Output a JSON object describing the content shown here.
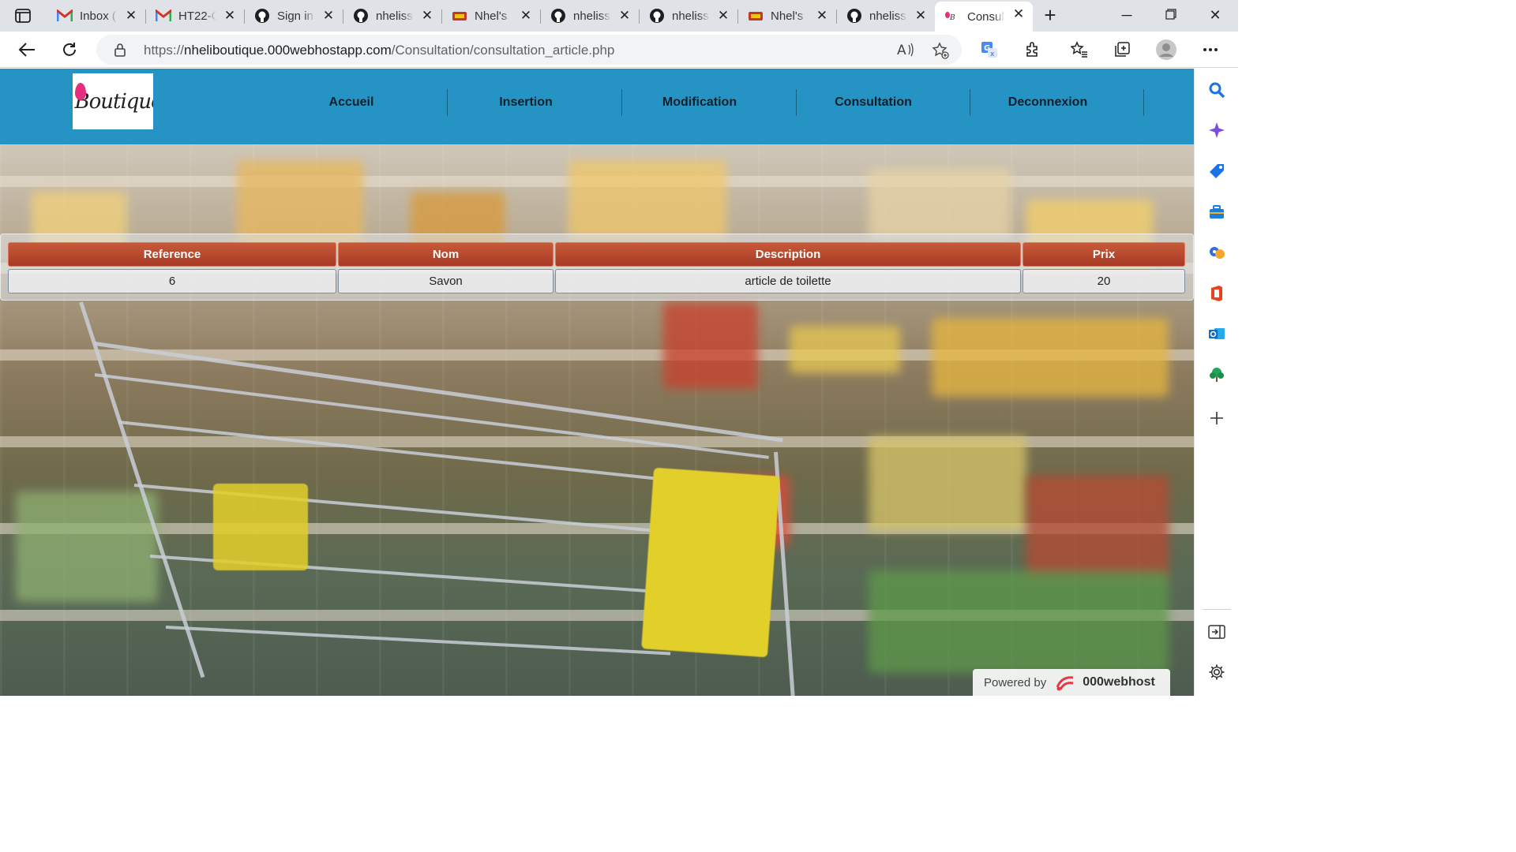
{
  "browser": {
    "tabs": [
      {
        "title": "Inbox (",
        "icon": "gmail-icon"
      },
      {
        "title": "HT22-C",
        "icon": "gmail-icon"
      },
      {
        "title": "Sign in",
        "icon": "github-icon"
      },
      {
        "title": "nheliss",
        "icon": "github-icon"
      },
      {
        "title": "Nhel's",
        "icon": "nhel-icon"
      },
      {
        "title": "nheliss",
        "icon": "github-icon"
      },
      {
        "title": "nheliss",
        "icon": "github-icon"
      },
      {
        "title": "Nhel's",
        "icon": "nhel-icon"
      },
      {
        "title": "nheliss",
        "icon": "github-icon"
      },
      {
        "title": "Consul",
        "icon": "boutique-icon",
        "active": true
      }
    ],
    "url_scheme": "https://",
    "url_host": "nheliboutique.000webhostapp.com",
    "url_path": "/Consultation/consultation_article.php"
  },
  "site": {
    "logo_text": "Boutique",
    "nav": [
      "Accueil",
      "Insertion",
      "Modification",
      "Consultation",
      "Deconnexion"
    ]
  },
  "table": {
    "headers": [
      "Reference",
      "Nom",
      "Description",
      "Prix"
    ],
    "rows": [
      [
        "6",
        "Savon",
        "article de toilette",
        "20"
      ]
    ]
  },
  "footer": {
    "powered_by": "Powered by",
    "brand": "000webhost"
  },
  "colors": {
    "header_bg": "#2593c4",
    "table_header": "#b5452c",
    "brand_pink": "#e52f7c"
  }
}
